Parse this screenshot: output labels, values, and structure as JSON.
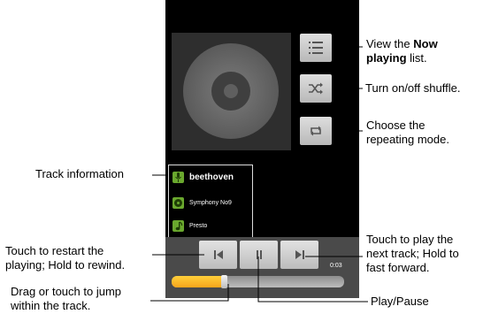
{
  "player": {
    "track": {
      "artist": "beethoven",
      "album": "Symphony No9",
      "song": "Presto"
    },
    "time_elapsed": "0:03",
    "progress_fraction": 0.3,
    "accent_color": "#f7a51b",
    "icons": {
      "now_playing": "list-icon",
      "shuffle": "shuffle-icon",
      "repeat": "repeat-icon",
      "previous": "skip-previous-icon",
      "pause": "pause-icon",
      "next": "skip-next-icon",
      "artist": "microphone-icon",
      "album": "disc-icon",
      "song": "music-note-icon"
    }
  },
  "callouts": {
    "now_playing_part1": "View the ",
    "now_playing_bold1": "Now",
    "now_playing_bold2": "playing",
    "now_playing_part2": " list.",
    "shuffle": "Turn on/off shuffle.",
    "repeat_line1": "Choose the",
    "repeat_line2": "repeating mode.",
    "track_info": "Track information",
    "restart_line1": "Touch to restart the",
    "restart_line2": "playing; Hold to rewind.",
    "next_line1": "Touch to play the",
    "next_line2": "next track; Hold to",
    "next_line3": "fast forward.",
    "seek_line1": "Drag or touch to jump",
    "seek_line2": "within the track.",
    "play_pause": "Play/Pause"
  }
}
